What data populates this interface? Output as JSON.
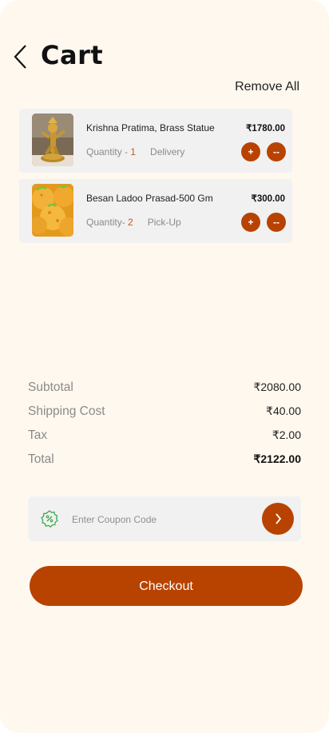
{
  "header": {
    "title": "Cart",
    "remove_all_label": "Remove All"
  },
  "items": [
    {
      "name": "Krishna Pratima, Brass Statue",
      "qty_label": "Quantity - ",
      "qty": "1",
      "mode": "Delivery",
      "price": "₹1780.00",
      "plus": "+",
      "minus": "--",
      "image": "brass-statue-image"
    },
    {
      "name": "Besan Ladoo Prasad-500 Gm",
      "qty_label": "Quantity- ",
      "qty": "2",
      "mode": "Pick-Up",
      "price": "₹300.00",
      "plus": "+",
      "minus": "--",
      "image": "besan-ladoo-image"
    }
  ],
  "summary": {
    "subtotal_label": "Subtotal",
    "subtotal": "₹2080.00",
    "shipping_label": "Shipping Cost",
    "shipping": "₹40.00",
    "tax_label": "Tax",
    "tax": "₹2.00",
    "total_label": "Total",
    "total": "₹2122.00"
  },
  "coupon": {
    "placeholder": "Enter Coupon Code",
    "value": "",
    "icon": "coupon-percent-icon",
    "submit_icon": "chevron-right-icon"
  },
  "checkout_label": "Checkout",
  "colors": {
    "background": "#fff8ee",
    "accent": "#b84300",
    "card": "#f1f1f1",
    "quantity": "#c8561a",
    "coupon_icon": "#3aa84b"
  }
}
